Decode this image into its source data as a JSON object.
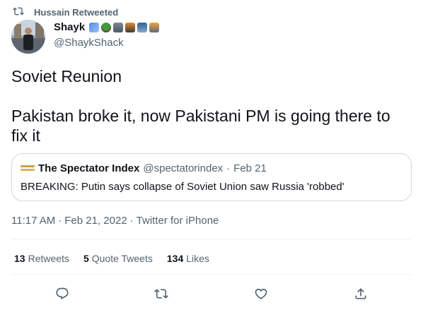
{
  "retweet": {
    "label": "Hussain Retweeted",
    "icon": "retweet-icon"
  },
  "author": {
    "display_name": "Shayk",
    "handle": "@ShaykShack",
    "name_emojis": [
      "kite",
      "tree",
      "person",
      "cyclist",
      "city",
      "car"
    ]
  },
  "tweet": {
    "text": "Soviet Reunion\n\nPakistan broke it, now Pakistani PM is going there to fix it"
  },
  "quote": {
    "name": "The Spectator Index",
    "handle": "@spectatorindex",
    "separator": "·",
    "date": "Feb 21",
    "body": "BREAKING: Putin says collapse of Soviet Union saw Russia 'robbed'"
  },
  "meta": {
    "time": "11:17 AM",
    "sep1": "·",
    "date": "Feb 21, 2022",
    "sep2": "·",
    "source": "Twitter for iPhone"
  },
  "stats": {
    "retweets_count": "13",
    "retweets_label": "Retweets",
    "quotes_count": "5",
    "quotes_label": "Quote Tweets",
    "likes_count": "134",
    "likes_label": "Likes"
  },
  "actions": [
    "reply-icon",
    "retweet-icon",
    "like-icon",
    "share-icon"
  ],
  "colors": {
    "text": "#0f1419",
    "secondary": "#536471",
    "border": "#cfd9de"
  }
}
